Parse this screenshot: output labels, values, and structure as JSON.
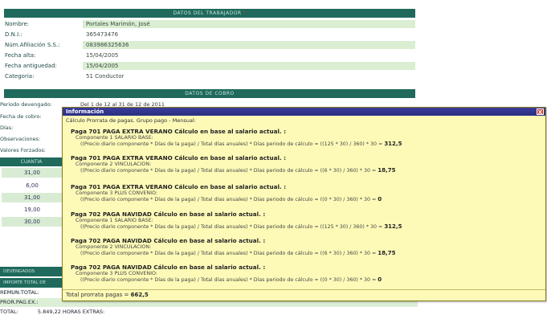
{
  "worker": {
    "header": "DATOS DEL TRABAJADOR",
    "header_mark": "*",
    "fields": [
      {
        "label": "Nombre:",
        "value": "Portales Marimón, José"
      },
      {
        "label": "D.N.I.:",
        "value": "365473476"
      },
      {
        "label": "Núm.Afiliación S.S.:",
        "value": "083986325636"
      },
      {
        "label": "Fecha alta:",
        "value": "15/04/2005"
      },
      {
        "label": "Fecha antiguedad:",
        "value": "15/04/2005"
      },
      {
        "label": "Categoria:",
        "value": "51 Conductor"
      }
    ]
  },
  "cobro": {
    "header": "DATOS DE COBRO",
    "periodo_label": "Periodo devengado:",
    "periodo_value": "Del 1 de 12 al 31 de 12 de 2011",
    "labels": [
      "Fecha de cobro:",
      "Días:",
      "Observaciones:",
      "Valores Forzados:"
    ],
    "cuantia_header": "CUANTIA",
    "cuantias": [
      "31,00",
      "6,00",
      "31,00",
      "19,00",
      "30,00"
    ]
  },
  "bottom": {
    "green1": "DEVENGADOS COMPONENTES",
    "green2": "IMPORTE TOTAL DE COTIZACION",
    "row1_label": "REMUN.TOTAL:",
    "row1_value": "",
    "row2_label": "PROR.PAG.EX.:",
    "row2_value": "",
    "row3_label": "TOTAL:",
    "row3_value": "5.849,22 HORAS EXTRAS:"
  },
  "dialog": {
    "title": "Información",
    "close": "X",
    "subtitle": "Cálculo Prorrata de pagas. Grupo pago - Mensual:",
    "blocks": [
      {
        "title": "Paga 701 PAGA EXTRA VERANO Cálculo en base al salario actual. :",
        "component": "Componente 1 SALARIO BASE:",
        "formula": "((Precio diario componente * Días de la paga) / Total días anuales) * Días periodo de cálculo = ((125 * 30) / 360) * 30 =",
        "result": "312,5"
      },
      {
        "title": "Paga 701 PAGA EXTRA VERANO Cálculo en base al salario actual. :",
        "component": "Componente 2 VINCULACION:",
        "formula": "((Precio diario componente * Días de la paga) / Total días anuales) * Días periodo de cálculo = ((6 * 30) / 360) * 30 =",
        "result": "18,75"
      },
      {
        "title": "Paga 701 PAGA EXTRA VERANO Cálculo en base al salario actual. :",
        "component": "Componente 3 PLUS CONVENIO:",
        "formula": "((Precio diario componente * Días de la paga) / Total días anuales) * Días periodo de cálculo = ((0 * 30) / 360) * 30 =",
        "result": "0"
      },
      {
        "title": "Paga 702 PAGA NAVIDAD Cálculo en base al salario actual. :",
        "component": "Componente 1 SALARIO BASE:",
        "formula": "((Precio diario componente * Días de la paga) / Total días anuales) * Días periodo de cálculo = ((125 * 30) / 360) * 30 =",
        "result": "312,5"
      },
      {
        "title": "Paga 702 PAGA NAVIDAD Cálculo en base al salario actual. :",
        "component": "Componente 2 VINCULACION:",
        "formula": "((Precio diario componente * Días de la paga) / Total días anuales) * Días periodo de cálculo = ((6 * 30) / 360) * 30 =",
        "result": "18,75"
      },
      {
        "title": "Paga 702 PAGA NAVIDAD Cálculo en base al salario actual. :",
        "component": "Componente 3 PLUS CONVENIO:",
        "formula": "((Precio diario componente * Días de la paga) / Total días anuales) * Días periodo de cálculo = ((0 * 30) / 360) * 30 =",
        "result": "0"
      }
    ],
    "total_label": "Total prorrata pagas =",
    "total_value": "662,5"
  },
  "colors": {
    "header_green": "#1f6a5c",
    "row_green": "#daeed2",
    "dialog_bg": "#fdfab8",
    "title_bar": "#2a2f82",
    "close_red": "#d43a2a"
  }
}
